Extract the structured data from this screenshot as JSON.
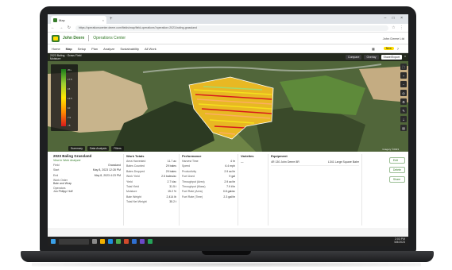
{
  "browser": {
    "tab_title": "Map",
    "url": "https://operationscenter.deere.com/fields/map/field-operations?operation=2023-baling-grassland",
    "window_controls": "– □ ×"
  },
  "app": {
    "brand": "John Deere",
    "product": "Operations Center",
    "user": "John Deere Ltd",
    "menu": [
      "Home",
      "Map",
      "Setup",
      "Plan",
      "Analyze",
      "Sustainability",
      "All Work"
    ],
    "badge": "New"
  },
  "map": {
    "field_title": "2023 Baling · Grass Field",
    "field_subtitle": "Moisture",
    "actions": [
      "Compare",
      "Overlay",
      "Share/Export"
    ],
    "legend_labels": [
      "20+",
      "17.5",
      "15",
      "12.5",
      "10",
      "7.5",
      "<5"
    ],
    "bottom_chips": [
      "Summary",
      "Data Analysis",
      "Filters"
    ],
    "attribution": "Imagery ©2023",
    "tools": [
      "⛶",
      "+",
      "−",
      "◎",
      "⚙",
      "✎",
      "⇣",
      "▤"
    ]
  },
  "operation": {
    "title": "2023 Baling Grassland",
    "link": "View in Work Analyzer",
    "fields": [
      {
        "k": "Field",
        "v": "Grassland"
      },
      {
        "k": "Start",
        "v": "May 8, 2023 12:28 PM"
      },
      {
        "k": "End",
        "v": "May 8, 2023 4:23 PM"
      }
    ],
    "workorder_label": "Work Order",
    "workorder_value": "Bale and Wrap",
    "operators_label": "Operators",
    "operators_value": "Jon Philipp Hoff"
  },
  "work_totals": {
    "heading": "Work Totals",
    "rows": [
      {
        "k": "Area Harvested",
        "v": "11.7 ac"
      },
      {
        "k": "Bales Counted",
        "v": "29 bales"
      },
      {
        "k": "Bales Dropped",
        "v": "29 bales"
      },
      {
        "k": "Work Yield",
        "v": "2.5 bales/ac"
      },
      {
        "k": "Yield",
        "v": "2.7 t/ac"
      },
      {
        "k": "Total Yield",
        "v": "31.5 t"
      },
      {
        "k": "Moisture",
        "v": "15.2 %"
      },
      {
        "k": "Bale Weight",
        "v": "2,414 lb"
      },
      {
        "k": "Total Net Weight",
        "v": "35.2 t"
      }
    ]
  },
  "performance": {
    "heading": "Performance",
    "rows": [
      {
        "k": "Harvest Time",
        "v": "4 hr"
      },
      {
        "k": "Speed",
        "v": "6.4 mph"
      },
      {
        "k": "Productivity",
        "v": "2.9 ac/hr"
      },
      {
        "k": "Fuel Used",
        "v": "9 gal"
      },
      {
        "k": "Throughput (Area)",
        "v": "2.9 ac/hr"
      },
      {
        "k": "Throughput (Mass)",
        "v": "7.9 t/hr"
      },
      {
        "k": "Fuel Rate (Area)",
        "v": "0.8 gal/ac"
      },
      {
        "k": "Fuel Rate (Time)",
        "v": "2.3 gal/hr"
      }
    ]
  },
  "varieties": {
    "heading": "Varieties",
    "value": "—"
  },
  "equipment": {
    "heading": "Equipment",
    "rows": [
      {
        "k": "4R 130 John Deere 8R",
        "v": "L341 Large Square Baler"
      }
    ]
  },
  "panel_actions": [
    "Edit",
    "Delete",
    "Share"
  ],
  "taskbar": {
    "time": "2:03 PM",
    "date": "5/8/2023"
  },
  "colors": {
    "brand_green": "#367c2b",
    "brand_yellow": "#ffde00"
  }
}
